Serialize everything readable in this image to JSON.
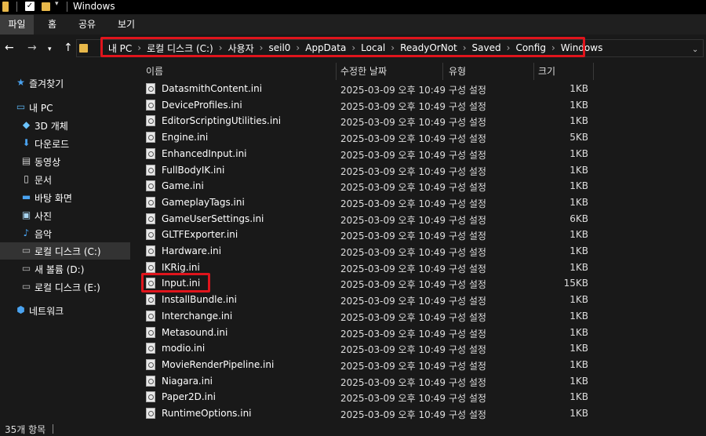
{
  "window": {
    "title": "Windows"
  },
  "ribbon": {
    "tabs": [
      "파일",
      "홈",
      "공유",
      "보기"
    ]
  },
  "address": {
    "crumbs": [
      "내 PC",
      "로컬 디스크 (C:)",
      "사용자",
      "seil0",
      "AppData",
      "Local",
      "ReadyOrNot",
      "Saved",
      "Config",
      "Windows"
    ]
  },
  "sidebar": {
    "items": [
      {
        "label": "즐겨찾기",
        "icon": "star-icon"
      },
      {
        "label": "내 PC",
        "icon": "computer-icon"
      },
      {
        "label": "3D 개체",
        "icon": "3d-objects-icon"
      },
      {
        "label": "다운로드",
        "icon": "download-icon"
      },
      {
        "label": "동영상",
        "icon": "video-icon"
      },
      {
        "label": "문서",
        "icon": "document-icon"
      },
      {
        "label": "바탕 화면",
        "icon": "desktop-icon"
      },
      {
        "label": "사진",
        "icon": "pictures-icon"
      },
      {
        "label": "음악",
        "icon": "music-icon"
      },
      {
        "label": "로컬 디스크 (C:)",
        "icon": "drive-icon"
      },
      {
        "label": "새 볼륨 (D:)",
        "icon": "drive-icon"
      },
      {
        "label": "로컬 디스크 (E:)",
        "icon": "drive-icon"
      },
      {
        "label": "네트워크",
        "icon": "network-icon"
      }
    ]
  },
  "columns": {
    "name": "이름",
    "date": "수정한 날짜",
    "type": "유형",
    "size": "크기"
  },
  "files": [
    {
      "name": "DatasmithContent.ini",
      "date": "2025-03-09 오후 10:49",
      "type": "구성 설정",
      "size": "1KB"
    },
    {
      "name": "DeviceProfiles.ini",
      "date": "2025-03-09 오후 10:49",
      "type": "구성 설정",
      "size": "1KB"
    },
    {
      "name": "EditorScriptingUtilities.ini",
      "date": "2025-03-09 오후 10:49",
      "type": "구성 설정",
      "size": "1KB"
    },
    {
      "name": "Engine.ini",
      "date": "2025-03-09 오후 10:49",
      "type": "구성 설정",
      "size": "5KB"
    },
    {
      "name": "EnhancedInput.ini",
      "date": "2025-03-09 오후 10:49",
      "type": "구성 설정",
      "size": "1KB"
    },
    {
      "name": "FullBodyIK.ini",
      "date": "2025-03-09 오후 10:49",
      "type": "구성 설정",
      "size": "1KB"
    },
    {
      "name": "Game.ini",
      "date": "2025-03-09 오후 10:49",
      "type": "구성 설정",
      "size": "1KB"
    },
    {
      "name": "GameplayTags.ini",
      "date": "2025-03-09 오후 10:49",
      "type": "구성 설정",
      "size": "1KB"
    },
    {
      "name": "GameUserSettings.ini",
      "date": "2025-03-09 오후 10:49",
      "type": "구성 설정",
      "size": "6KB"
    },
    {
      "name": "GLTFExporter.ini",
      "date": "2025-03-09 오후 10:49",
      "type": "구성 설정",
      "size": "1KB"
    },
    {
      "name": "Hardware.ini",
      "date": "2025-03-09 오후 10:49",
      "type": "구성 설정",
      "size": "1KB"
    },
    {
      "name": "IKRig.ini",
      "date": "2025-03-09 오후 10:49",
      "type": "구성 설정",
      "size": "1KB"
    },
    {
      "name": "Input.ini",
      "date": "2025-03-09 오후 10:49",
      "type": "구성 설정",
      "size": "15KB"
    },
    {
      "name": "InstallBundle.ini",
      "date": "2025-03-09 오후 10:49",
      "type": "구성 설정",
      "size": "1KB"
    },
    {
      "name": "Interchange.ini",
      "date": "2025-03-09 오후 10:49",
      "type": "구성 설정",
      "size": "1KB"
    },
    {
      "name": "Metasound.ini",
      "date": "2025-03-09 오후 10:49",
      "type": "구성 설정",
      "size": "1KB"
    },
    {
      "name": "modio.ini",
      "date": "2025-03-09 오후 10:49",
      "type": "구성 설정",
      "size": "1KB"
    },
    {
      "name": "MovieRenderPipeline.ini",
      "date": "2025-03-09 오후 10:49",
      "type": "구성 설정",
      "size": "1KB"
    },
    {
      "name": "Niagara.ini",
      "date": "2025-03-09 오후 10:49",
      "type": "구성 설정",
      "size": "1KB"
    },
    {
      "name": "Paper2D.ini",
      "date": "2025-03-09 오후 10:49",
      "type": "구성 설정",
      "size": "1KB"
    },
    {
      "name": "RuntimeOptions.ini",
      "date": "2025-03-09 오후 10:49",
      "type": "구성 설정",
      "size": "1KB"
    }
  ],
  "status": {
    "count": "35개 항목"
  },
  "colors": {
    "highlight": "#e0141c",
    "folder": "#e8b84a"
  }
}
